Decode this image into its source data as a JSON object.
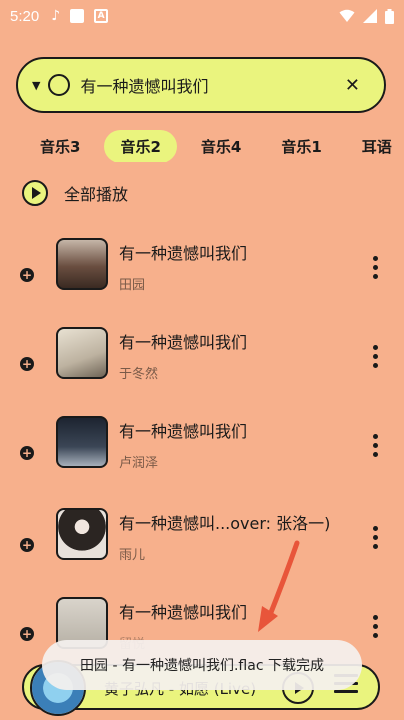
{
  "status_bar": {
    "time": "5:20",
    "notif_music": "♪",
    "notif_a": "A"
  },
  "search": {
    "query": "有一种遗憾叫我们",
    "close_icon": "✕",
    "dropdown_icon": "▼"
  },
  "tabs": [
    {
      "label": "音乐3",
      "active": false
    },
    {
      "label": "音乐2",
      "active": true
    },
    {
      "label": "音乐4",
      "active": false
    },
    {
      "label": "音乐1",
      "active": false
    },
    {
      "label": "耳语",
      "active": false
    }
  ],
  "play_all": {
    "label": "全部播放"
  },
  "songs": [
    {
      "title": "有一种遗憾叫我们",
      "artist": "田园"
    },
    {
      "title": "有一种遗憾叫我们",
      "artist": "于冬然"
    },
    {
      "title": "有一种遗憾叫我们",
      "artist": "卢润泽"
    },
    {
      "title": "有一种遗憾叫...over: 张洛一)",
      "artist": "雨儿"
    },
    {
      "title": "有一种遗憾叫我们",
      "artist": "留悦"
    }
  ],
  "player": {
    "title": "黄子弘凡 - 如愿 (Live)"
  },
  "toast": {
    "message": "田园 - 有一种遗憾叫我们.flac 下载完成"
  },
  "colors": {
    "background": "#F7B08C",
    "accent": "#EAF47E",
    "arrow": "#E8553A"
  }
}
